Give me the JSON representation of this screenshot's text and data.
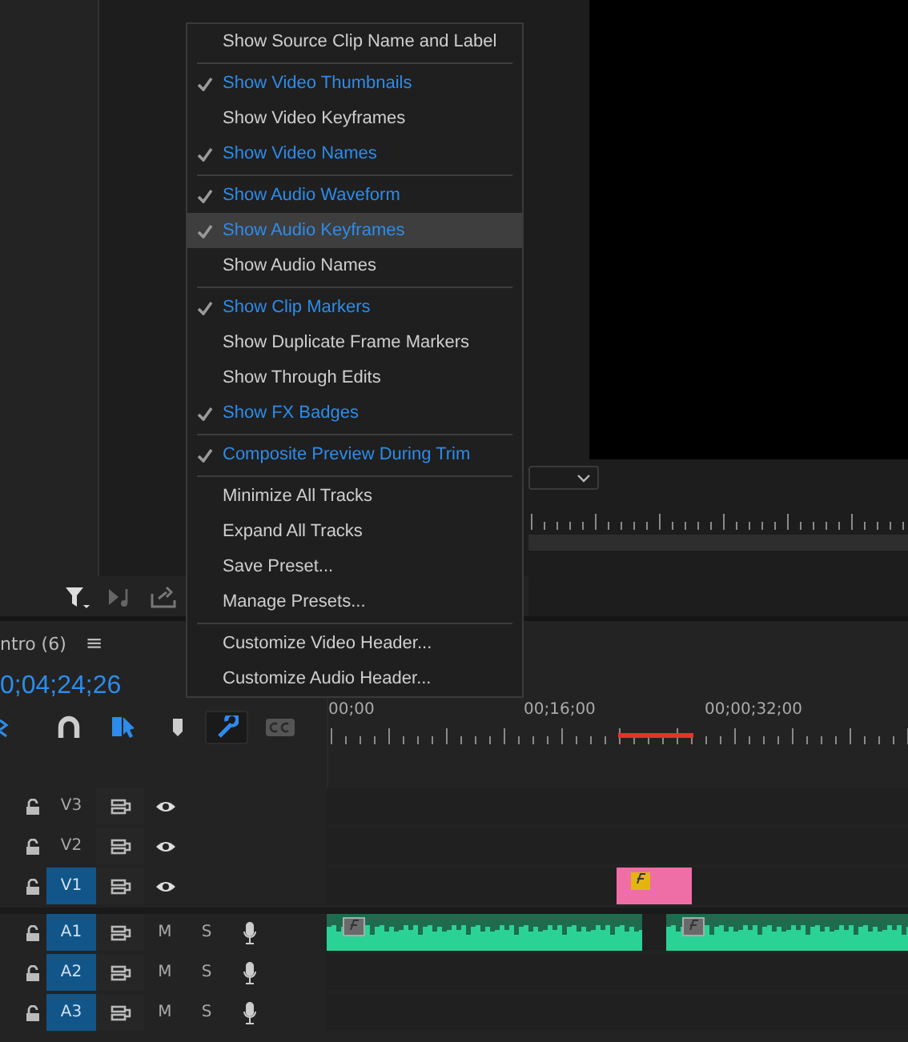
{
  "menu": {
    "items": [
      {
        "kind": "item",
        "label": "Show Source Clip Name and Label",
        "checked": false,
        "highlighted": false
      },
      {
        "kind": "separator"
      },
      {
        "kind": "item",
        "label": "Show Video Thumbnails",
        "checked": true,
        "highlighted": false
      },
      {
        "kind": "item",
        "label": "Show Video Keyframes",
        "checked": false,
        "highlighted": false
      },
      {
        "kind": "item",
        "label": "Show Video Names",
        "checked": true,
        "highlighted": false
      },
      {
        "kind": "separator"
      },
      {
        "kind": "item",
        "label": "Show Audio Waveform",
        "checked": true,
        "highlighted": false
      },
      {
        "kind": "item",
        "label": "Show Audio Keyframes",
        "checked": true,
        "highlighted": true
      },
      {
        "kind": "item",
        "label": "Show Audio Names",
        "checked": false,
        "highlighted": false
      },
      {
        "kind": "separator"
      },
      {
        "kind": "item",
        "label": "Show Clip Markers",
        "checked": true,
        "highlighted": false
      },
      {
        "kind": "item",
        "label": "Show Duplicate Frame Markers",
        "checked": false,
        "highlighted": false
      },
      {
        "kind": "item",
        "label": "Show Through Edits",
        "checked": false,
        "highlighted": false
      },
      {
        "kind": "item",
        "label": "Show FX Badges",
        "checked": true,
        "highlighted": false
      },
      {
        "kind": "separator"
      },
      {
        "kind": "item",
        "label": "Composite Preview During Trim",
        "checked": true,
        "highlighted": false
      },
      {
        "kind": "separator"
      },
      {
        "kind": "item",
        "label": "Minimize All Tracks",
        "checked": false,
        "highlighted": false
      },
      {
        "kind": "item",
        "label": "Expand All Tracks",
        "checked": false,
        "highlighted": false
      },
      {
        "kind": "item",
        "label": "Save Preset...",
        "checked": false,
        "highlighted": false
      },
      {
        "kind": "item",
        "label": "Manage Presets...",
        "checked": false,
        "highlighted": false
      },
      {
        "kind": "separator"
      },
      {
        "kind": "item",
        "label": "Customize Video Header...",
        "checked": false,
        "highlighted": false
      },
      {
        "kind": "item",
        "label": "Customize Audio Header...",
        "checked": false,
        "highlighted": false
      }
    ]
  },
  "timeline": {
    "sequence_tab": "ntro (6)",
    "panel_menu": "≡",
    "timecode": "0;04;24;26",
    "ruler_labels": [
      "00;00",
      "00;16;00",
      "00;00;32;00"
    ],
    "tools": [
      {
        "kind": "ripple",
        "selected": false
      },
      {
        "kind": "snap",
        "selected": false
      },
      {
        "kind": "linked",
        "selected": false
      },
      {
        "kind": "marker",
        "selected": false
      },
      {
        "kind": "settings",
        "selected": true
      },
      {
        "kind": "captions",
        "selected": false
      }
    ],
    "tracks": [
      {
        "kind": "video",
        "name": "V3",
        "targeted": false
      },
      {
        "kind": "video",
        "name": "V2",
        "targeted": false
      },
      {
        "kind": "video",
        "name": "V1",
        "targeted": true,
        "clips": [
          {
            "kind": "video",
            "fx": true
          }
        ]
      },
      {
        "kind": "audio",
        "name": "A1",
        "targeted": true,
        "mute": "M",
        "solo": "S",
        "clips": [
          {
            "kind": "audio",
            "fx": true
          },
          {
            "kind": "audio",
            "fx": true
          }
        ]
      },
      {
        "kind": "audio",
        "name": "A2",
        "targeted": true,
        "mute": "M",
        "solo": "S"
      },
      {
        "kind": "audio",
        "name": "A3",
        "targeted": true,
        "mute": "M",
        "solo": "S"
      }
    ]
  }
}
